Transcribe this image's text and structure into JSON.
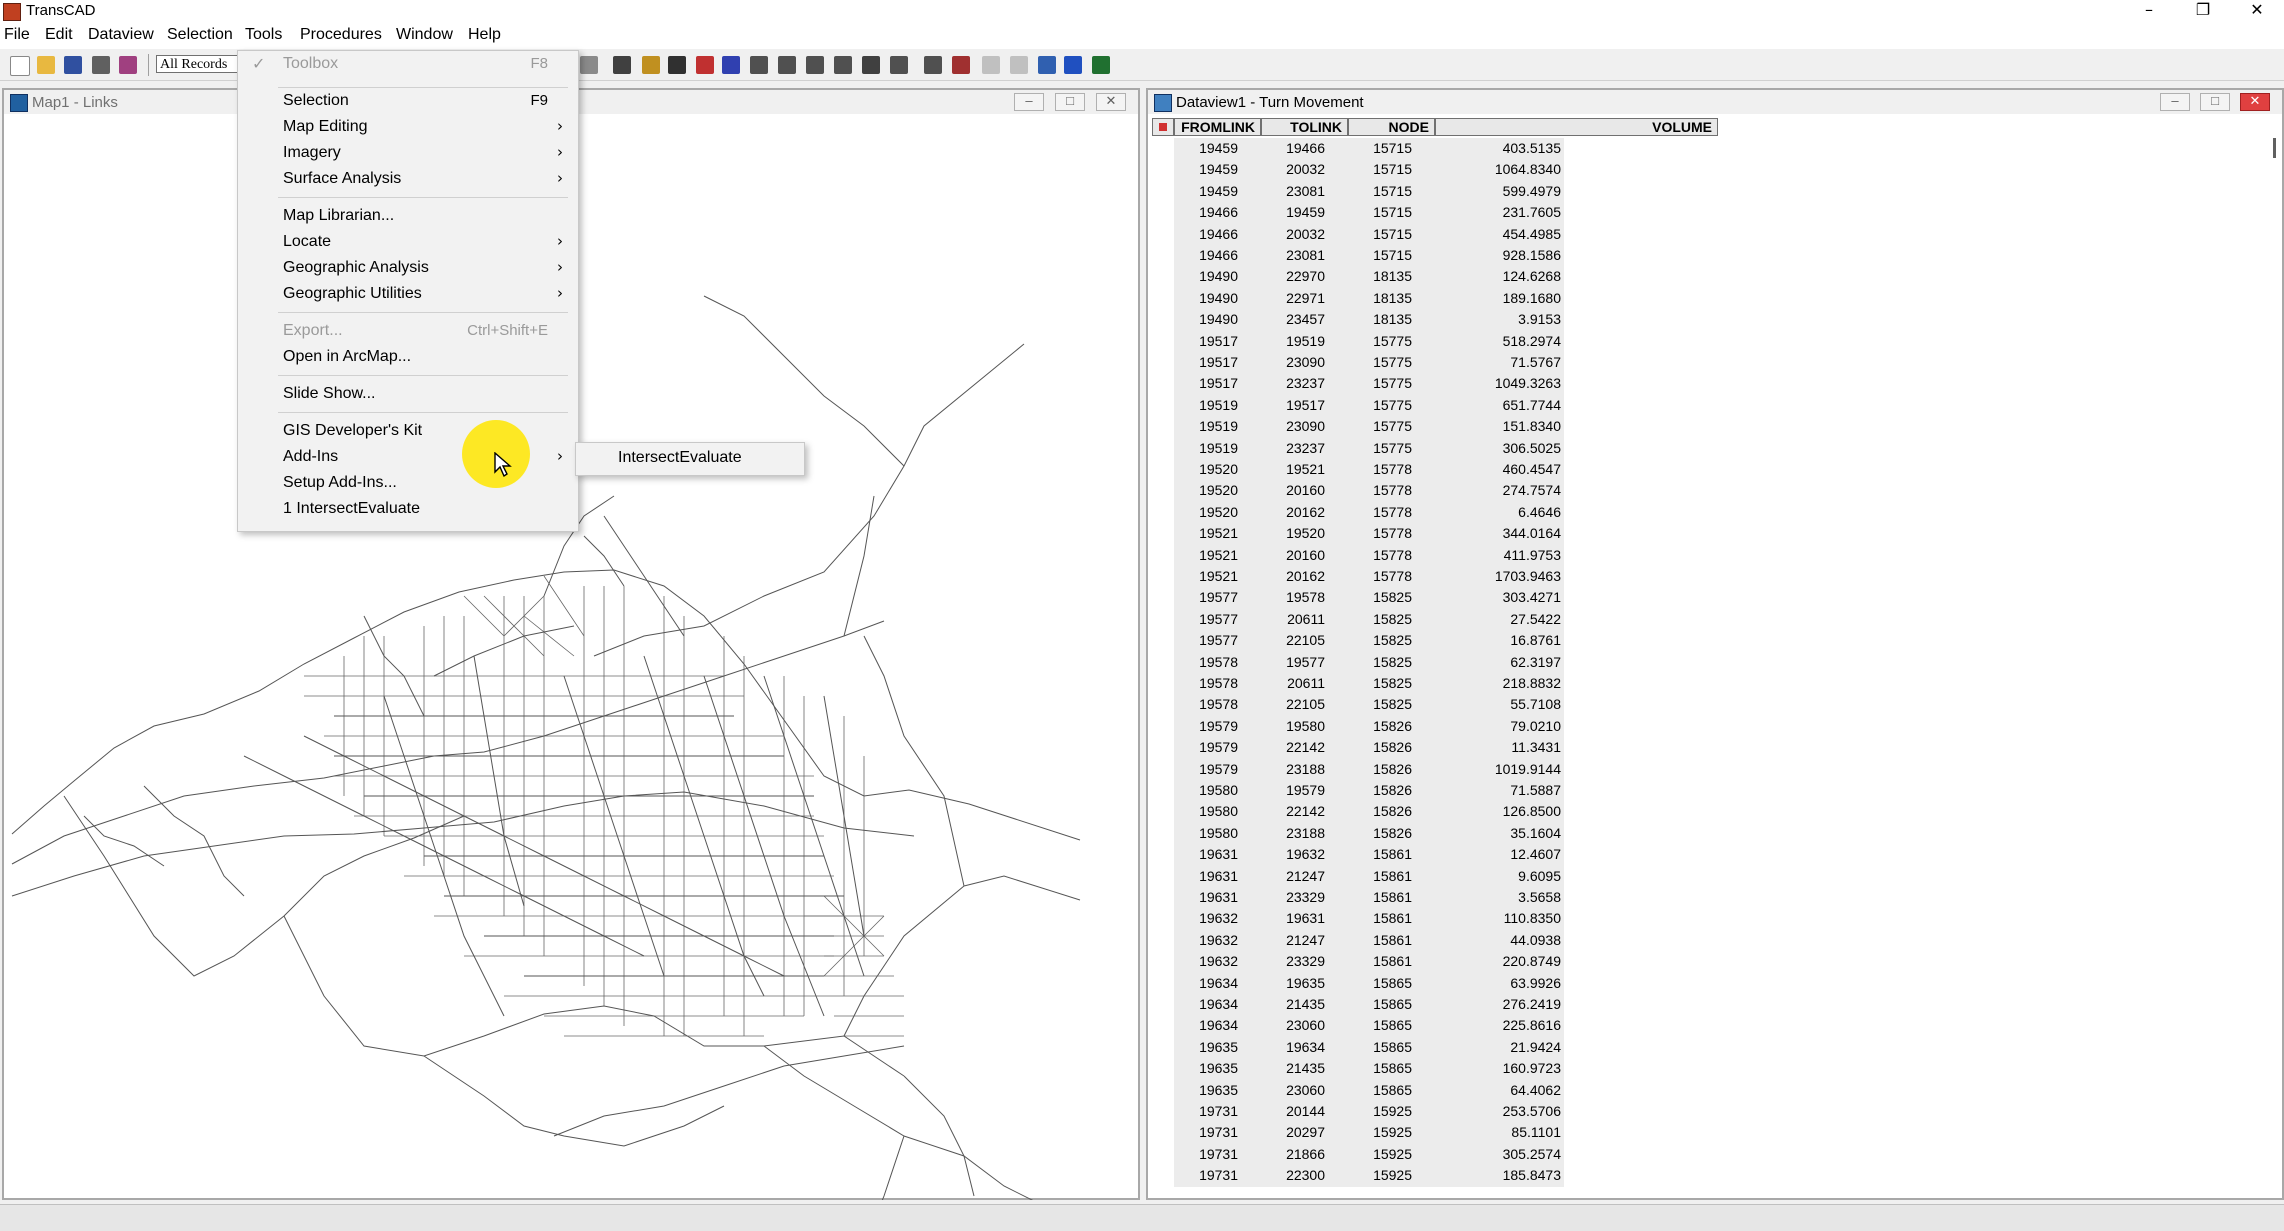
{
  "app": {
    "title": "TransCAD"
  },
  "menubar": {
    "items": [
      "File",
      "Edit",
      "Dataview",
      "Selection",
      "Tools",
      "Procedures",
      "Window",
      "Help"
    ]
  },
  "toolbar": {
    "scope_value": "All Records"
  },
  "map_window": {
    "title": "Map1 - Links"
  },
  "dataview_window": {
    "title": "Dataview1 - Turn Movement"
  },
  "tools_menu": {
    "items": [
      {
        "label": "Toolbox",
        "shortcut": "F8",
        "checked": true,
        "disabled": true
      },
      {
        "label": "Selection",
        "shortcut": "F9"
      },
      {
        "label": "Map Editing",
        "submenu": true
      },
      {
        "label": "Imagery",
        "submenu": true
      },
      {
        "label": "Surface Analysis",
        "submenu": true
      },
      {
        "label": "Map Librarian..."
      },
      {
        "label": "Locate",
        "submenu": true
      },
      {
        "label": "Geographic Analysis",
        "submenu": true
      },
      {
        "label": "Geographic Utilities",
        "submenu": true
      },
      {
        "label": "Export...",
        "shortcut": "Ctrl+Shift+E",
        "disabled": true
      },
      {
        "label": "Open in ArcMap..."
      },
      {
        "label": "Slide Show..."
      },
      {
        "label": "GIS Developer's Kit"
      },
      {
        "label": "Add-Ins",
        "submenu": true
      },
      {
        "label": "Setup Add-Ins..."
      },
      {
        "label": "1 IntersectEvaluate"
      }
    ]
  },
  "addins_submenu": {
    "items": [
      "IntersectEvaluate"
    ]
  },
  "table": {
    "columns": [
      "FROMLINK",
      "TOLINK",
      "NODE",
      "VOLUME"
    ],
    "rows": [
      [
        "19459",
        "19466",
        "15715",
        "403.5135"
      ],
      [
        "19459",
        "20032",
        "15715",
        "1064.8340"
      ],
      [
        "19459",
        "23081",
        "15715",
        "599.4979"
      ],
      [
        "19466",
        "19459",
        "15715",
        "231.7605"
      ],
      [
        "19466",
        "20032",
        "15715",
        "454.4985"
      ],
      [
        "19466",
        "23081",
        "15715",
        "928.1586"
      ],
      [
        "19490",
        "22970",
        "18135",
        "124.6268"
      ],
      [
        "19490",
        "22971",
        "18135",
        "189.1680"
      ],
      [
        "19490",
        "23457",
        "18135",
        "3.9153"
      ],
      [
        "19517",
        "19519",
        "15775",
        "518.2974"
      ],
      [
        "19517",
        "23090",
        "15775",
        "71.5767"
      ],
      [
        "19517",
        "23237",
        "15775",
        "1049.3263"
      ],
      [
        "19519",
        "19517",
        "15775",
        "651.7744"
      ],
      [
        "19519",
        "23090",
        "15775",
        "151.8340"
      ],
      [
        "19519",
        "23237",
        "15775",
        "306.5025"
      ],
      [
        "19520",
        "19521",
        "15778",
        "460.4547"
      ],
      [
        "19520",
        "20160",
        "15778",
        "274.7574"
      ],
      [
        "19520",
        "20162",
        "15778",
        "6.4646"
      ],
      [
        "19521",
        "19520",
        "15778",
        "344.0164"
      ],
      [
        "19521",
        "20160",
        "15778",
        "411.9753"
      ],
      [
        "19521",
        "20162",
        "15778",
        "1703.9463"
      ],
      [
        "19577",
        "19578",
        "15825",
        "303.4271"
      ],
      [
        "19577",
        "20611",
        "15825",
        "27.5422"
      ],
      [
        "19577",
        "22105",
        "15825",
        "16.8761"
      ],
      [
        "19578",
        "19577",
        "15825",
        "62.3197"
      ],
      [
        "19578",
        "20611",
        "15825",
        "218.8832"
      ],
      [
        "19578",
        "22105",
        "15825",
        "55.7108"
      ],
      [
        "19579",
        "19580",
        "15826",
        "79.0210"
      ],
      [
        "19579",
        "22142",
        "15826",
        "11.3431"
      ],
      [
        "19579",
        "23188",
        "15826",
        "1019.9144"
      ],
      [
        "19580",
        "19579",
        "15826",
        "71.5887"
      ],
      [
        "19580",
        "22142",
        "15826",
        "126.8500"
      ],
      [
        "19580",
        "23188",
        "15826",
        "35.1604"
      ],
      [
        "19631",
        "19632",
        "15861",
        "12.4607"
      ],
      [
        "19631",
        "21247",
        "15861",
        "9.6095"
      ],
      [
        "19631",
        "23329",
        "15861",
        "3.5658"
      ],
      [
        "19632",
        "19631",
        "15861",
        "110.8350"
      ],
      [
        "19632",
        "21247",
        "15861",
        "44.0938"
      ],
      [
        "19632",
        "23329",
        "15861",
        "220.8749"
      ],
      [
        "19634",
        "19635",
        "15865",
        "63.9926"
      ],
      [
        "19634",
        "21435",
        "15865",
        "276.2419"
      ],
      [
        "19634",
        "23060",
        "15865",
        "225.8616"
      ],
      [
        "19635",
        "19634",
        "15865",
        "21.9424"
      ],
      [
        "19635",
        "21435",
        "15865",
        "160.9723"
      ],
      [
        "19635",
        "23060",
        "15865",
        "64.4062"
      ],
      [
        "19731",
        "20144",
        "15925",
        "253.5706"
      ],
      [
        "19731",
        "20297",
        "15925",
        "85.1101"
      ],
      [
        "19731",
        "21866",
        "15925",
        "305.2574"
      ],
      [
        "19731",
        "22300",
        "15925",
        "185.8473"
      ]
    ]
  },
  "colors": {
    "accent": "#0a6ab8",
    "cursor_highlight": "#ffe600",
    "map_lines": "#555555"
  }
}
